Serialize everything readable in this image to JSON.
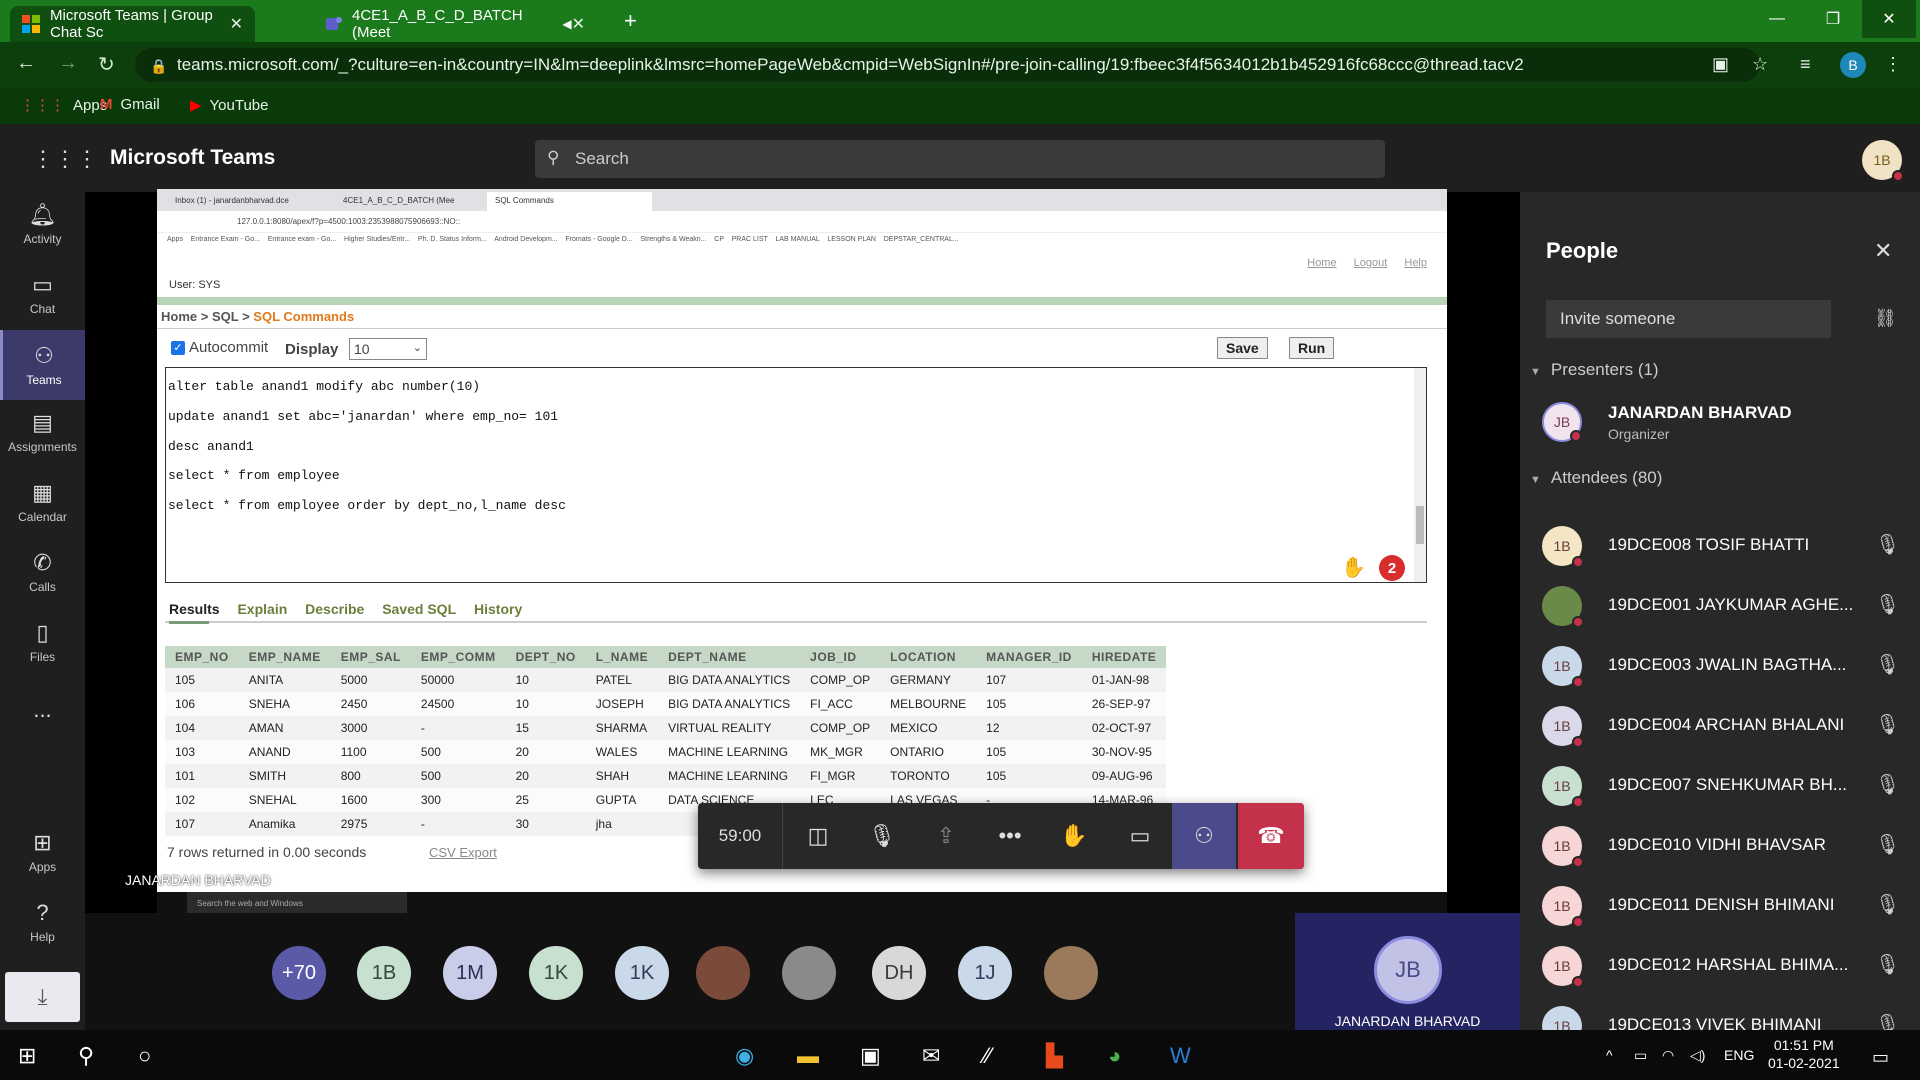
{
  "browser": {
    "tabs": [
      {
        "title": "Microsoft Teams | Group Chat Sc",
        "close": "✕"
      },
      {
        "title": "4CE1_A_B_C_D_BATCH (Meet",
        "close": "✕"
      }
    ],
    "new_tab": "+",
    "url": "teams.microsoft.com/_?culture=en-in&country=IN&lm=deeplink&lmsrc=homePageWeb&cmpid=WebSignIn#/pre-join-calling/19:fbeec3f4f5634012b1b452916fc68ccc@thread.tacv2",
    "profile_initial": "B",
    "bookmarks": [
      "Apps",
      "Gmail",
      "YouTube"
    ]
  },
  "teams": {
    "app_title": "Microsoft Teams",
    "search_placeholder": "Search",
    "me_initials": "1B",
    "rail": [
      {
        "label": "Activity",
        "icon": "bell-icon"
      },
      {
        "label": "Chat",
        "icon": "chat-icon"
      },
      {
        "label": "Teams",
        "icon": "teams-icon"
      },
      {
        "label": "Assignments",
        "icon": "assignments-icon"
      },
      {
        "label": "Calendar",
        "icon": "calendar-icon"
      },
      {
        "label": "Calls",
        "icon": "phone-icon"
      },
      {
        "label": "Files",
        "icon": "file-icon"
      },
      {
        "label": "...",
        "icon": "more-icon"
      },
      {
        "label": "Apps",
        "icon": "apps-icon"
      },
      {
        "label": "Help",
        "icon": "help-icon"
      }
    ]
  },
  "shared_screen": {
    "user": "User: SYS",
    "links": [
      "Home",
      "Logout",
      "Help"
    ],
    "breadcrumb": {
      "home": "Home",
      "sep1": " > ",
      "sql": "SQL",
      "sep2": " > ",
      "current": "SQL Commands"
    },
    "autocommit_label": "Autocommit",
    "display_label": "Display",
    "display_value": "10",
    "save_label": "Save",
    "run_label": "Run",
    "sql_lines": [
      "alter table anand1 modify abc number(10)",
      "update anand1 set abc='janardan' where emp_no= 101",
      "desc anand1",
      "select * from employee",
      "select * from employee order by dept_no,l_name desc"
    ],
    "badge_count": "2",
    "result_tabs": [
      "Results",
      "Explain",
      "Describe",
      "Saved SQL",
      "History"
    ],
    "columns": [
      "EMP_NO",
      "EMP_NAME",
      "EMP_SAL",
      "EMP_COMM",
      "DEPT_NO",
      "L_NAME",
      "DEPT_NAME",
      "JOB_ID",
      "LOCATION",
      "MANAGER_ID",
      "HIREDATE"
    ],
    "rows": [
      [
        "105",
        "ANITA",
        "5000",
        "50000",
        "10",
        "PATEL",
        "BIG DATA ANALYTICS",
        "COMP_OP",
        "GERMANY",
        "107",
        "01-JAN-98"
      ],
      [
        "106",
        "SNEHA",
        "2450",
        "24500",
        "10",
        "JOSEPH",
        "BIG DATA ANALYTICS",
        "FI_ACC",
        "MELBOURNE",
        "105",
        "26-SEP-97"
      ],
      [
        "104",
        "AMAN",
        "3000",
        "-",
        "15",
        "SHARMA",
        "VIRTUAL REALITY",
        "COMP_OP",
        "MEXICO",
        "12",
        "02-OCT-97"
      ],
      [
        "103",
        "ANAND",
        "1100",
        "500",
        "20",
        "WALES",
        "MACHINE LEARNING",
        "MK_MGR",
        "ONTARIO",
        "105",
        "30-NOV-95"
      ],
      [
        "101",
        "SMITH",
        "800",
        "500",
        "20",
        "SHAH",
        "MACHINE LEARNING",
        "FI_MGR",
        "TORONTO",
        "105",
        "09-AUG-96"
      ],
      [
        "102",
        "SNEHAL",
        "1600",
        "300",
        "25",
        "GUPTA",
        "DATA SCIENCE",
        "LEC",
        "LAS VEGAS",
        "-",
        "14-MAR-96"
      ],
      [
        "107",
        "Anamika",
        "2975",
        "-",
        "30",
        "jha",
        "",
        "",
        "",
        "",
        ""
      ]
    ],
    "rows_returned": "7 rows returned in 0.00 seconds",
    "csv_export": "CSV Export",
    "presenter_overlay": "JANARDAN BHARVAD"
  },
  "call_controls": {
    "timer": "59:00"
  },
  "participants_strip": [
    {
      "initials": "+70",
      "color": "#5b5aa8",
      "text_color": "#ffffff"
    },
    {
      "initials": "1B",
      "color": "#c8e0d0",
      "text_color": "#2d4a3a"
    },
    {
      "initials": "1M",
      "color": "#c9cde9",
      "text_color": "#2d2d5a"
    },
    {
      "initials": "1K",
      "color": "#c8e0d0",
      "text_color": "#2d4a3a"
    },
    {
      "initials": "1K",
      "color": "#c9d9e9",
      "text_color": "#2d3d5a"
    },
    {
      "initials": "",
      "color": "#7a4a3a",
      "text_color": "#ffffff"
    },
    {
      "initials": "",
      "color": "#8a8a8a",
      "text_color": "#ffffff"
    },
    {
      "initials": "DH",
      "color": "#d8d8d8",
      "text_color": "#3a3a3a"
    },
    {
      "initials": "1J",
      "color": "#c9d9e9",
      "text_color": "#2d3d5a"
    },
    {
      "initials": "",
      "color": "#9a7a5a",
      "text_color": "#ffffff"
    }
  ],
  "presenter_tile": {
    "initials": "JB",
    "name": "JANARDAN BHARVAD"
  },
  "people_panel": {
    "title": "People",
    "invite_placeholder": "Invite someone",
    "presenters_header": "Presenters (1)",
    "presenter": {
      "initials": "JB",
      "name": "JANARDAN BHARVAD",
      "role": "Organizer"
    },
    "attendees_header": "Attendees (80)",
    "attendees": [
      {
        "initials": "1B",
        "name": "19DCE008 TOSIF BHATTI",
        "color": "#f4e6c4"
      },
      {
        "initials": "",
        "name": "19DCE001 JAYKUMAR AGHE...",
        "color": "#6a8a4a"
      },
      {
        "initials": "1B",
        "name": "19DCE003 JWALIN BAGTHA...",
        "color": "#c9d9e9"
      },
      {
        "initials": "1B",
        "name": "19DCE004 ARCHAN BHALANI",
        "color": "#d9d9e9"
      },
      {
        "initials": "1B",
        "name": "19DCE007 SNEHKUMAR BH...",
        "color": "#c8e0d0"
      },
      {
        "initials": "1B",
        "name": "19DCE010 VIDHI BHAVSAR",
        "color": "#f6d6d6"
      },
      {
        "initials": "1B",
        "name": "19DCE011 DENISH BHIMANI",
        "color": "#f6d6d6"
      },
      {
        "initials": "1B",
        "name": "19DCE012 HARSHAL BHIMA...",
        "color": "#f6d6d6"
      },
      {
        "initials": "1B",
        "name": "19DCE013 VIVEK BHIMANI",
        "color": "#c9d9e9"
      }
    ]
  },
  "windows_taskbar": {
    "lang": "ENG",
    "time": "01:51 PM",
    "date": "01-02-2021"
  }
}
